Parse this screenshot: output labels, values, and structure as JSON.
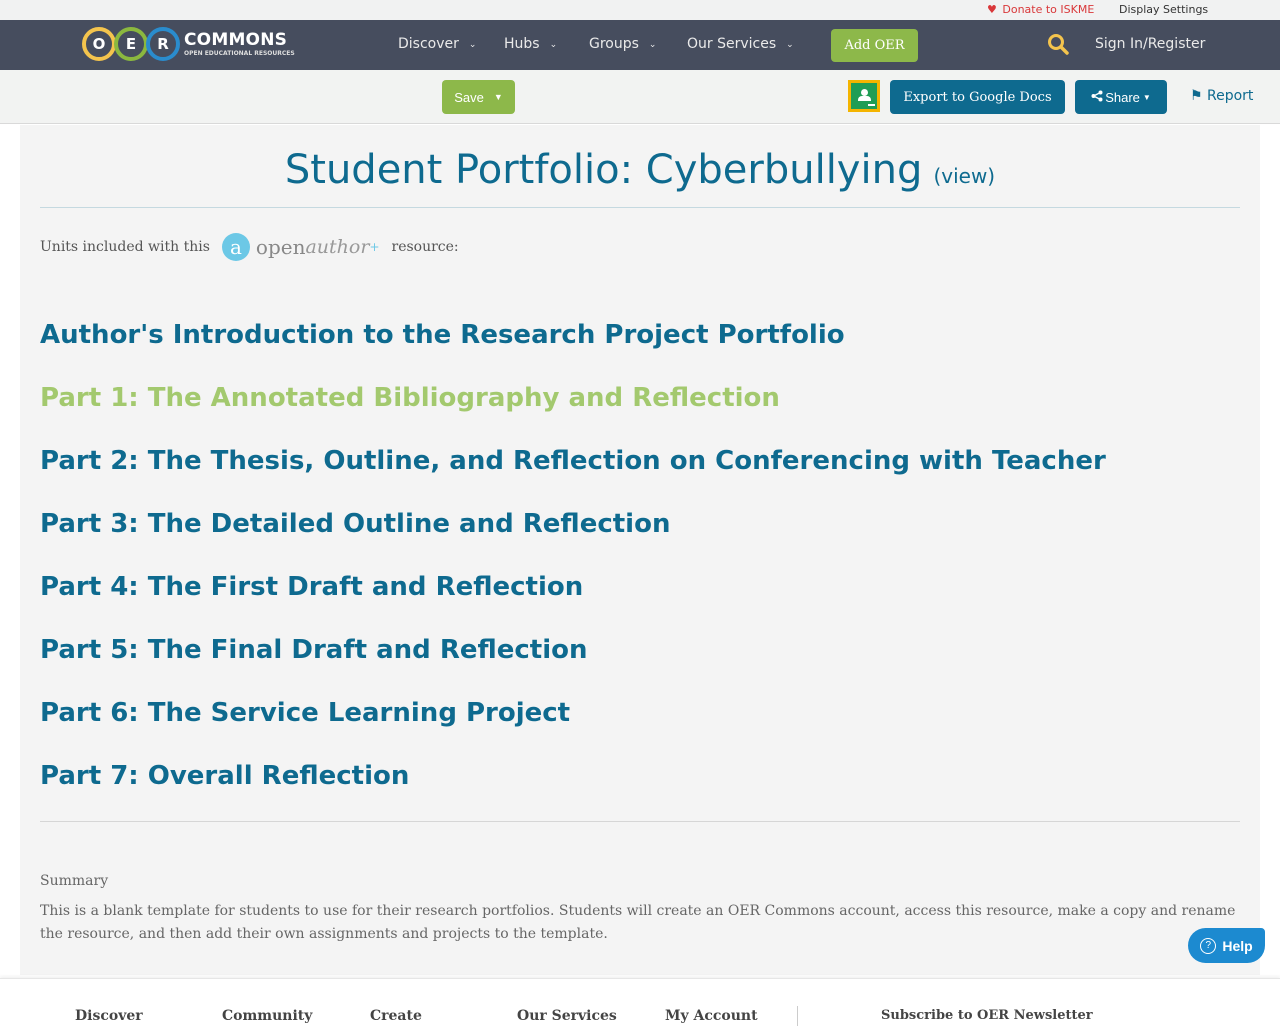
{
  "utility_bar": {
    "donate_label": "Donate to ISKME",
    "donate_color": "#d9383a",
    "display_settings_label": "Display Settings"
  },
  "nav": {
    "logo": {
      "letters": [
        "O",
        "E",
        "R"
      ],
      "title": "COMMONS",
      "subtitle": "OPEN EDUCATIONAL RESOURCES"
    },
    "items": [
      {
        "label": "Discover"
      },
      {
        "label": "Hubs"
      },
      {
        "label": "Groups"
      },
      {
        "label": "Our Services"
      }
    ],
    "add_oer_label": "Add OER",
    "search_icon": "search-icon",
    "sign_in_label": "Sign In/Register"
  },
  "toolbar": {
    "save_label": "Save",
    "google_classroom_icon": "google-classroom-icon",
    "export_label": "Export to Google Docs",
    "share_label": "Share",
    "report_label": "Report"
  },
  "main": {
    "title": "Student Portfolio: Cyberbullying",
    "view_link": "(view)",
    "units_prefix": "Units included with this",
    "openauthor_logo": {
      "open": "open",
      "author": "author",
      "plus": "+"
    },
    "units_suffix": "resource:",
    "units": [
      {
        "label": "Author's Introduction to the Research Project Portfolio",
        "active": false
      },
      {
        "label": "Part 1: The Annotated Bibliography and Reflection",
        "active": true
      },
      {
        "label": "Part 2: The Thesis, Outline, and Reflection on Conferencing with Teacher",
        "active": false
      },
      {
        "label": "Part 3: The Detailed Outline and Reflection",
        "active": false
      },
      {
        "label": "Part 4: The First Draft and Reflection",
        "active": false
      },
      {
        "label": "Part 5: The Final Draft and Reflection",
        "active": false
      },
      {
        "label": "Part 6: The Service Learning Project",
        "active": false
      },
      {
        "label": "Part 7: Overall Reflection",
        "active": false
      }
    ],
    "summary_label": "Summary",
    "summary_text": "This is a blank template for students to use for their research portfolios. Students will create an OER Commons account, access this resource, make a copy and rename the resource, and then add their own assignments and projects to the template."
  },
  "help_label": "Help",
  "footer": {
    "columns": [
      "Discover",
      "Community",
      "Create",
      "Our Services",
      "My Account"
    ],
    "subscribe_label": "Subscribe to OER Newsletter"
  },
  "colors": {
    "nav_bg": "#464d5e",
    "primary": "#0e6a8f",
    "accent_green": "#8db84a",
    "active_unit": "#a3c96e",
    "help_blue": "#1c8ad0"
  }
}
